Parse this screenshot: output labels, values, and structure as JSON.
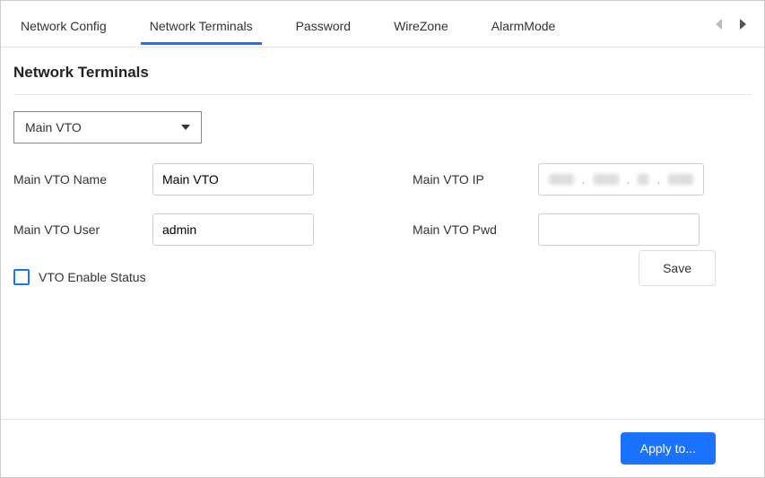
{
  "tabs": {
    "items": [
      {
        "label": "Network Config",
        "active": false
      },
      {
        "label": "Network Terminals",
        "active": true
      },
      {
        "label": "Password",
        "active": false
      },
      {
        "label": "WireZone",
        "active": false
      },
      {
        "label": "AlarmMode",
        "active": false
      }
    ]
  },
  "section": {
    "title": "Network Terminals"
  },
  "dropdown": {
    "selected": "Main VTO"
  },
  "form": {
    "vto_name_label": "Main VTO Name",
    "vto_name_value": "Main VTO",
    "vto_ip_label": "Main VTO IP",
    "vto_ip_value": "",
    "vto_user_label": "Main VTO User",
    "vto_user_value": "admin",
    "vto_pwd_label": "Main VTO Pwd",
    "vto_pwd_value": "",
    "enable_label": "VTO Enable Status",
    "enable_checked": false
  },
  "buttons": {
    "save": "Save",
    "apply": "Apply to..."
  }
}
